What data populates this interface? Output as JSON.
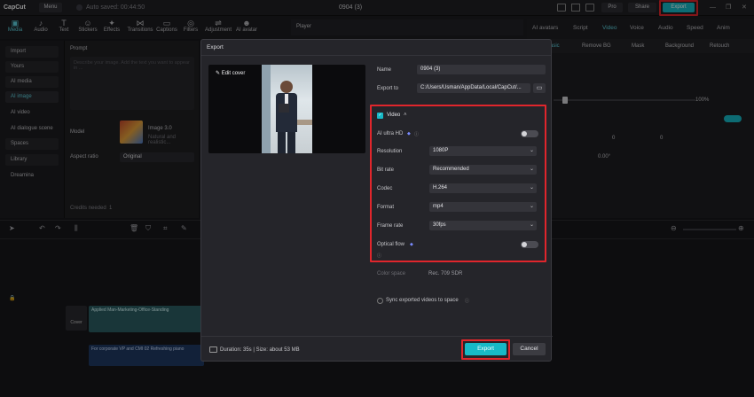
{
  "titlebar": {
    "app_name": "CapCut",
    "menu_label": "Menu",
    "autosave": "Auto saved: 00:44:50",
    "project_title": "0904 (3)",
    "pro_label": "Pro",
    "share_label": "Share",
    "export_label": "Export"
  },
  "toolbar": {
    "items": [
      "Media",
      "Audio",
      "Text",
      "Stickers",
      "Effects",
      "Transitions",
      "Captions",
      "Filters",
      "Adjustment",
      "AI avatar"
    ]
  },
  "left_panel": {
    "items": [
      "Import",
      "Yours",
      "AI media",
      "AI image",
      "AI video",
      "AI dialogue scene",
      "Spaces",
      "Library",
      "Dreamina"
    ]
  },
  "prompt_panel": {
    "prompt_label": "Prompt",
    "prompt_placeholder": "Describe your image. Add the text you want to appear in ...",
    "model_label": "Model",
    "model_name": "Image 3.0",
    "model_desc": "Natural and realistic...",
    "aspect_label": "Aspect ratio",
    "aspect_value": "Original",
    "credits": "Credits needed",
    "credits_value": "1"
  },
  "player": {
    "label": "Player"
  },
  "right_panel": {
    "tabs": [
      "AI avatars",
      "Script",
      "Video",
      "Voice",
      "Audio",
      "Speed",
      "Anim"
    ],
    "subtabs": [
      "Basic",
      "Remove BG",
      "Mask",
      "Background",
      "Retouch"
    ],
    "scale_value": "100%",
    "pos_x": "0",
    "pos_y": "0",
    "rotate": "0.00°"
  },
  "timeline": {
    "clip_label": "Applied Man-Marketing-Office-Standing",
    "cover_label": "Cover",
    "audio_label": "For corporate VP and CMI 02 Refreshing piano"
  },
  "modal": {
    "title": "Export",
    "edit_cover": "Edit cover",
    "name_label": "Name",
    "name_value": "0904 (3)",
    "export_to_label": "Export to",
    "export_to_value": "C:/Users/Usman/AppData/Local/CapCut/...",
    "video_label": "Video",
    "ai_ultra_hd": "AI ultra HD",
    "resolution_label": "Resolution",
    "resolution_value": "1080P",
    "bitrate_label": "Bit rate",
    "bitrate_value": "Recommended",
    "codec_label": "Codec",
    "codec_value": "H.264",
    "format_label": "Format",
    "format_value": "mp4",
    "framerate_label": "Frame rate",
    "framerate_value": "30fps",
    "optical_flow": "Optical flow",
    "color_space_label": "Color space",
    "color_space_value": "Rec. 709 SDR",
    "sync_label": "Sync exported videos to space",
    "duration_info": "Duration: 35s | Size: about 53 MB",
    "export_btn": "Export",
    "cancel_btn": "Cancel"
  },
  "colors": {
    "accent": "#17b9c7",
    "highlight_box": "#e0262c",
    "background": "#17171a"
  }
}
